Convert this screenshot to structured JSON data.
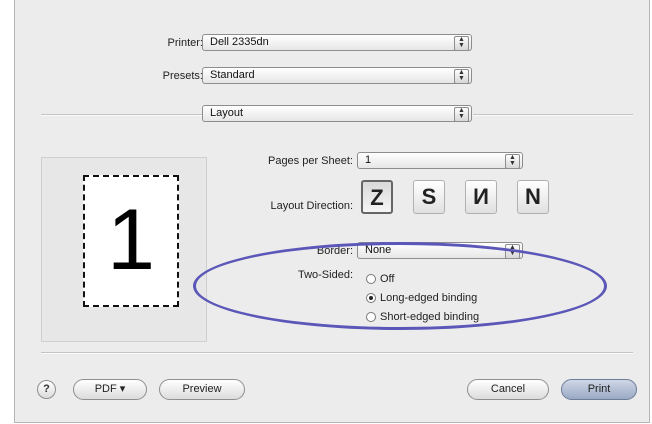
{
  "printer": {
    "label": "Printer:",
    "value": "Dell 2335dn"
  },
  "presets": {
    "label": "Presets:",
    "value": "Standard"
  },
  "panel": {
    "value": "Layout"
  },
  "preview": {
    "page_number": "1"
  },
  "layout": {
    "pages_per_sheet": {
      "label": "Pages per Sheet:",
      "value": "1"
    },
    "layout_direction": {
      "label": "Layout Direction:",
      "options": [
        "Z",
        "S",
        "И",
        "N"
      ],
      "selected": 0
    },
    "border": {
      "label": "Border:",
      "value": "None"
    },
    "two_sided": {
      "label": "Two-Sided:",
      "options": [
        {
          "label": "Off",
          "selected": false
        },
        {
          "label": "Long-edged binding",
          "selected": true
        },
        {
          "label": "Short-edged binding",
          "selected": false
        }
      ]
    }
  },
  "footer": {
    "help": "?",
    "pdf": "PDF ▾",
    "preview": "Preview",
    "cancel": "Cancel",
    "print": "Print"
  },
  "colors": {
    "highlight_ellipse": "#5b57b8",
    "dialog_bg": "#ececec"
  }
}
